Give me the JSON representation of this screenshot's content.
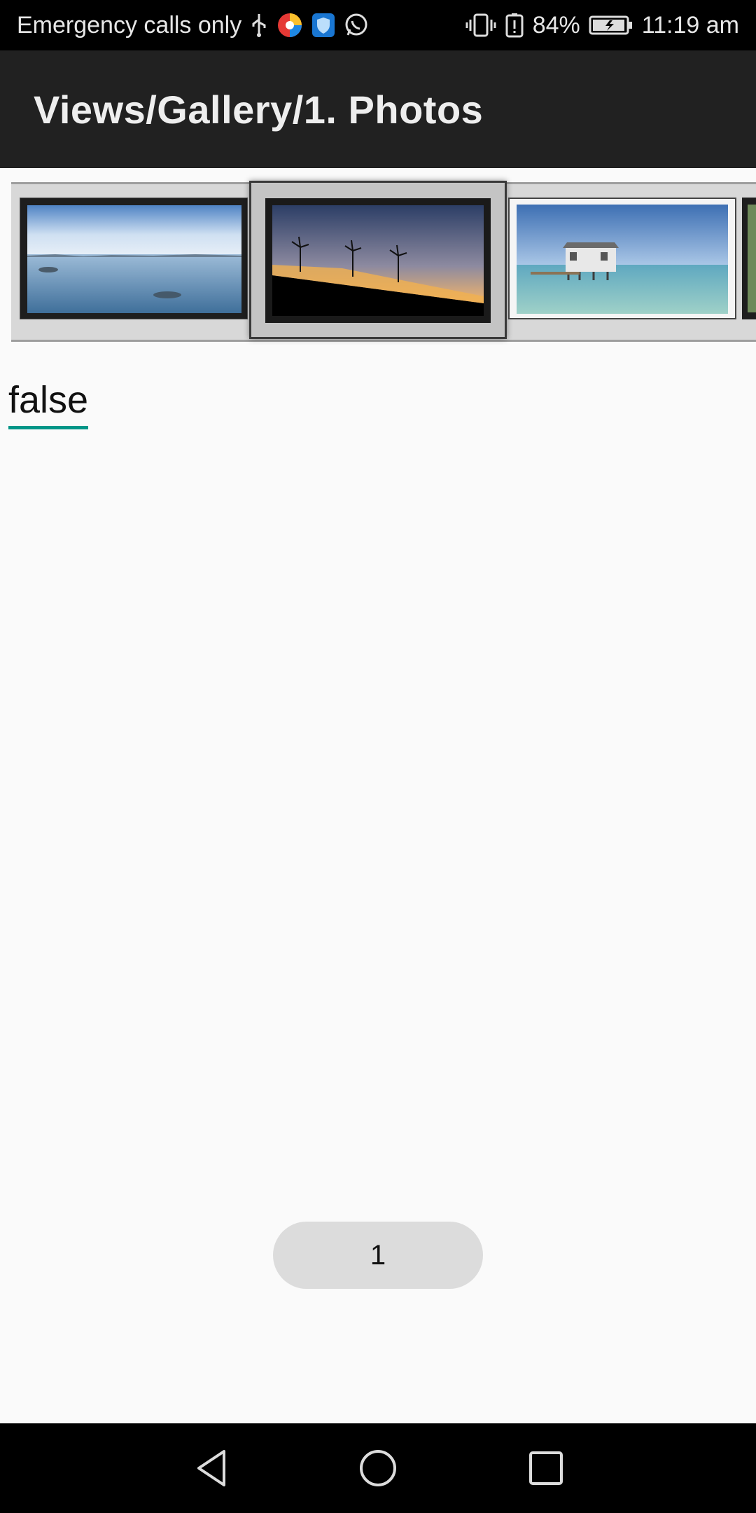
{
  "status_bar": {
    "carrier_text": "Emergency calls only",
    "battery_percent": "84%",
    "time": "11:19 am",
    "icons": [
      "usb-icon",
      "color-app-icon",
      "shield-icon",
      "whatsapp-icon",
      "vibrate-icon",
      "battery-alert-icon",
      "battery-icon"
    ]
  },
  "app_bar": {
    "title": "Views/Gallery/1. Photos"
  },
  "gallery": {
    "items": [
      {
        "name": "lake-photo",
        "selected": false
      },
      {
        "name": "windmills-sunset-photo",
        "selected": true
      },
      {
        "name": "water-house-photo",
        "selected": false
      }
    ]
  },
  "edit_text": {
    "value": "false"
  },
  "count_button": {
    "label": "1"
  },
  "nav_bar": {
    "icons": [
      "back-icon",
      "home-icon",
      "recents-icon"
    ]
  }
}
